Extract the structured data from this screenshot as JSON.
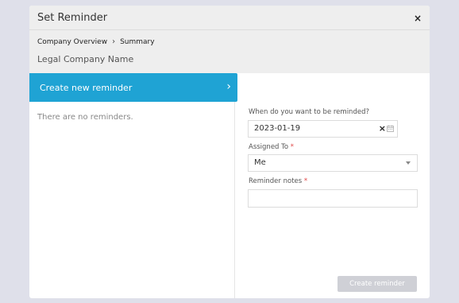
{
  "modal": {
    "title": "Set Reminder",
    "close_label": "×",
    "breadcrumb": [
      "Company Overview",
      "Summary"
    ],
    "breadcrumb_separator": "›",
    "subtitle": "Legal Company Name"
  },
  "left": {
    "create_label": "Create new reminder",
    "create_chevron": "›",
    "empty_text": "There are no reminders."
  },
  "form": {
    "date_label": "When do you want to be reminded?",
    "date_value": "2023-01-19",
    "date_clear": "×",
    "assigned_label": "Assigned To",
    "assigned_required": "*",
    "assigned_value": "Me",
    "notes_label": "Reminder notes",
    "notes_required": "*",
    "notes_value": "",
    "submit_label": "Create reminder"
  },
  "colors": {
    "accent": "#1fa3d4",
    "required": "#e04545",
    "disabled_button": "#cfd0d6"
  }
}
